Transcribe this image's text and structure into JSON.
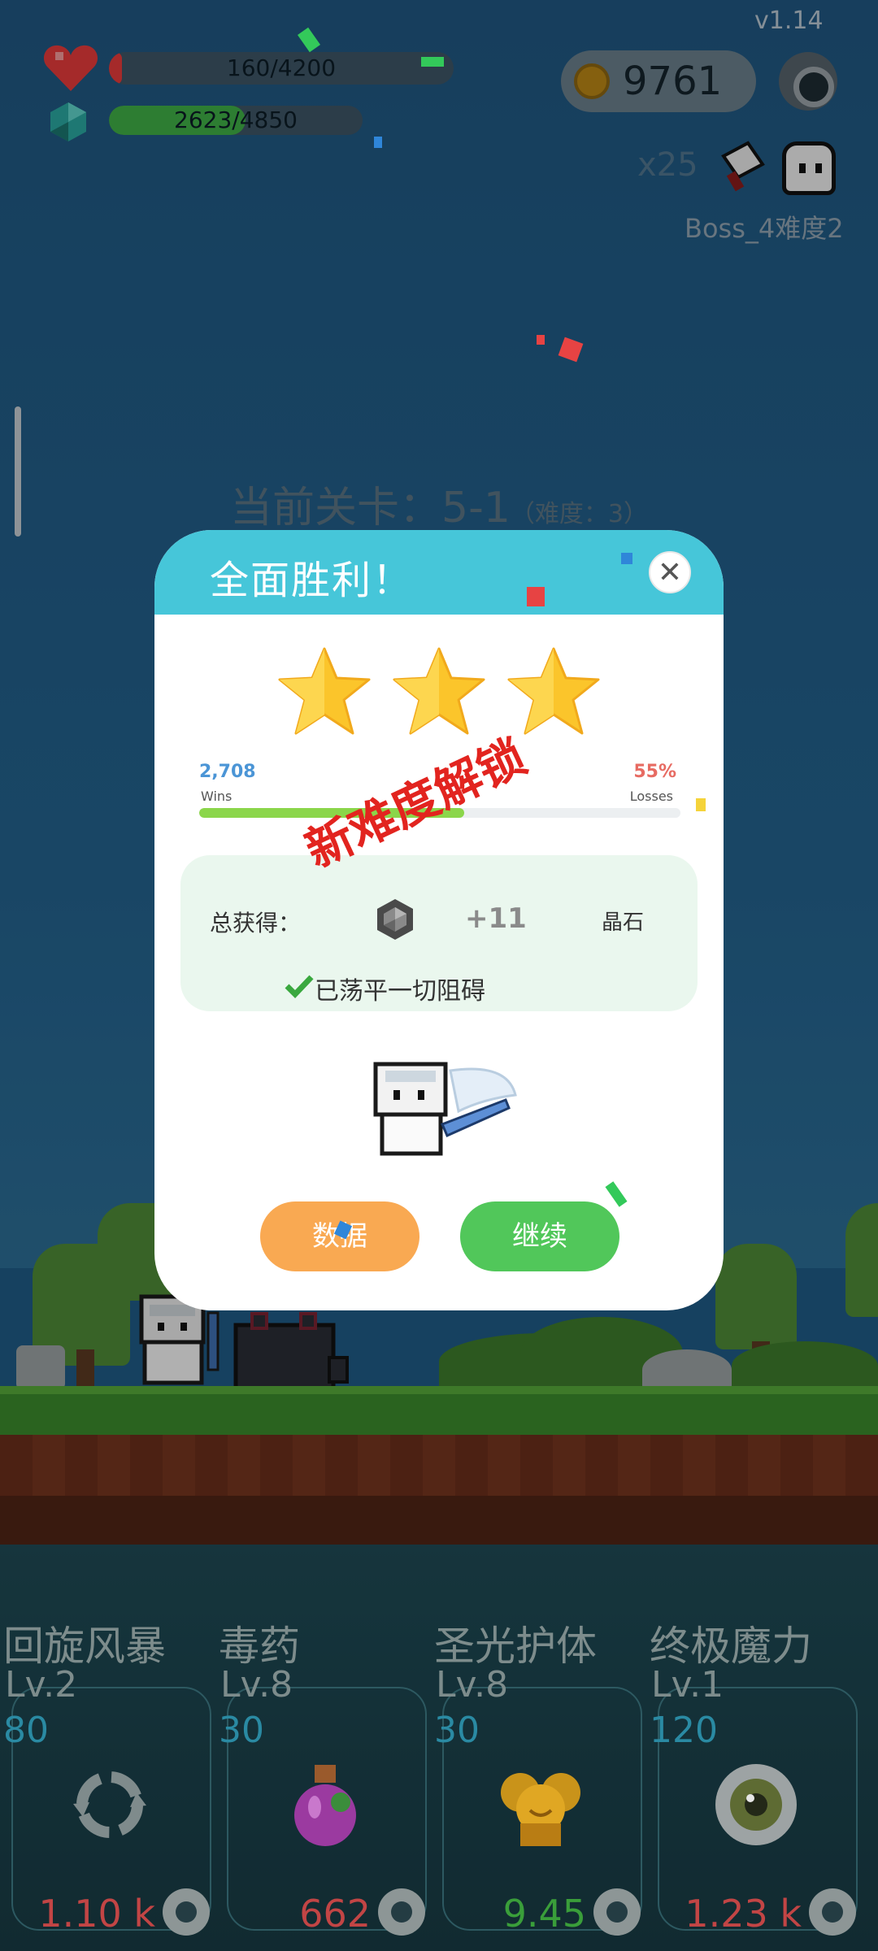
{
  "hud": {
    "version": "v1.14",
    "hp_text": "160/4200",
    "hp_fraction": 0.038,
    "xp_text": "2623/4850",
    "xp_fraction": 0.54,
    "coins": "9761",
    "multiplier": "x25",
    "boss_label": "Boss_4难度2",
    "colors": {
      "hp": "#e53b3b",
      "xp": "#3fae46",
      "coin": "#b98616"
    }
  },
  "stage": {
    "title": "当前关卡：5-1",
    "difficulty": "（难度：3）"
  },
  "popup": {
    "title": "全面胜利！",
    "close_icon": "close-icon",
    "stars": 3,
    "wins_value": "2,708",
    "wins_label": "Wins",
    "losses_value": "55%",
    "losses_label": "Losses",
    "win_ratio": 0.55,
    "unlock_stamp": "新难度解锁",
    "reward_label": "总获得：",
    "reward_amount": "+11",
    "reward_unit": "晶石",
    "reward_icon": "gem-icon",
    "clear_message": "已荡平一切阻碍",
    "buttons": {
      "data": "数据",
      "continue": "继续"
    },
    "colors": {
      "header": "#46c6d9",
      "data_button": "#f9a952",
      "continue_button": "#51c75a",
      "stamp": "#e2241f"
    }
  },
  "skills": [
    {
      "name": "回旋风暴",
      "level": "Lv.2",
      "cost": "80",
      "value": "1.10 k",
      "value_color": "#c24545",
      "icon": "whirlwind-icon"
    },
    {
      "name": "毒药",
      "level": "Lv.8",
      "cost": "30",
      "value": "662",
      "value_color": "#c24545",
      "icon": "poison-potion-icon"
    },
    {
      "name": "圣光护体",
      "level": "Lv.8",
      "cost": "30",
      "value": "9.45",
      "value_color": "#3a9e3a",
      "icon": "holy-light-icon"
    },
    {
      "name": "终极魔力",
      "level": "Lv.1",
      "cost": "120",
      "value": "1.23 k",
      "value_color": "#c24545",
      "icon": "ultimate-eye-icon"
    }
  ]
}
